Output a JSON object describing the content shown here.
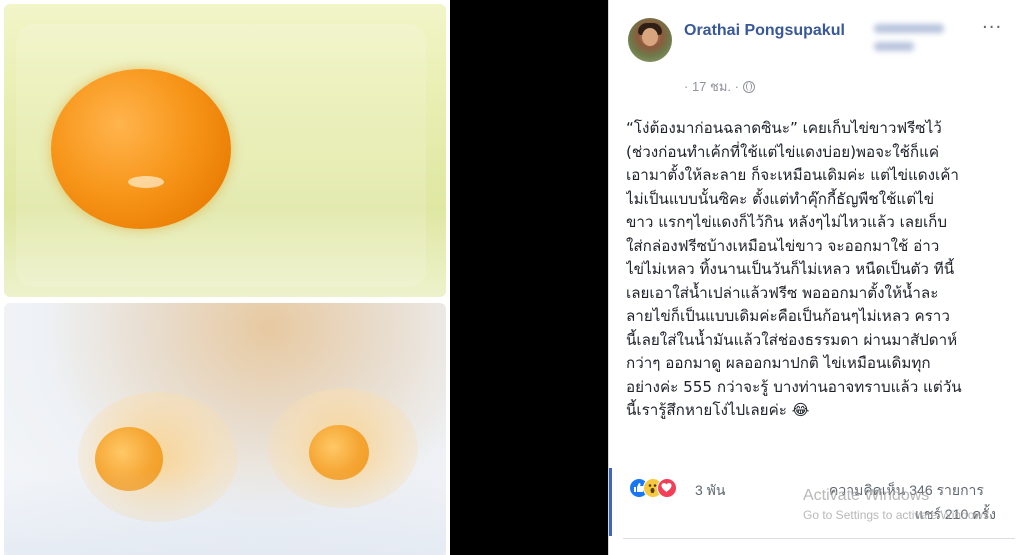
{
  "post": {
    "author": "Orathai Pongsupakul",
    "time": "· 17 ชม. ·",
    "text_lines": [
      "“โง่ต้องมาก่อนฉลาดซินะ” เคยเก็บไข่ขาวฟรีซไว้",
      "(ช่วงก่อนทำเค้กที่ใช้แต่ไข่แดงบ่อย)พอจะใช้ก็แค่",
      "เอามาตั้งให้ละลาย ก็จะเหมือนเดิมค่ะ แต่ไข่แดงเค้า",
      "ไม่เป็นแบบนั้นซิคะ ตั้งแต่ทำคุ๊กกี้ธัญพืชใช้แต่ไข่",
      "ขาว แรกๆไข่แดงก็ไว้กิน หลังๆไม่ไหวแล้ว เลยเก็บ",
      "ใส่กล่องฟรีซบ้างเหมือนไข่ขาว จะออกมาใช้ อ่าว",
      "ไข่ไม่เหลว ทิ้งนานเป็นวันก็ไม่เหลว หนืดเป็นตัว ทีนี้",
      "เลยเอาใส่น้ำเปล่าแล้วฟรีซ พอออกมาตั้งให้น้ำละ",
      "ลายไข่ก็เป็นแบบเดิมค่ะคือเป็นก้อนๆไม่เหลว คราว",
      "นี้เลยใส่ในน้ำมันแล้วใส่ช่องธรรมดา ผ่านมาสัปดาห์",
      "กว่าๆ ออกมาดู ผลออกมาปกติ ไข่เหมือนเดิมทุก",
      "อย่างค่ะ 555 กว่าจะรู้ บางท่านอาจทราบแล้ว แต่วัน",
      "นี้เรารู้สึกหายโง่ไปเลยค่ะ 😂"
    ],
    "reactions_count": "3 พัน",
    "comments": "ความคิดเห็น 346 รายการ",
    "shares": "แชร์ 210 ครั้ง",
    "more_icon": "···"
  },
  "watermark": {
    "line1": "Activate Windows",
    "line2": "Go to Settings to activate Windows."
  },
  "icons": [
    "globe-icon",
    "like-reaction-icon",
    "wow-reaction-icon",
    "love-reaction-icon",
    "more-options-icon"
  ],
  "colors": {
    "author": "#385898",
    "like": "#1877f2",
    "love": "#f33e58",
    "wow": "#f7c940"
  }
}
